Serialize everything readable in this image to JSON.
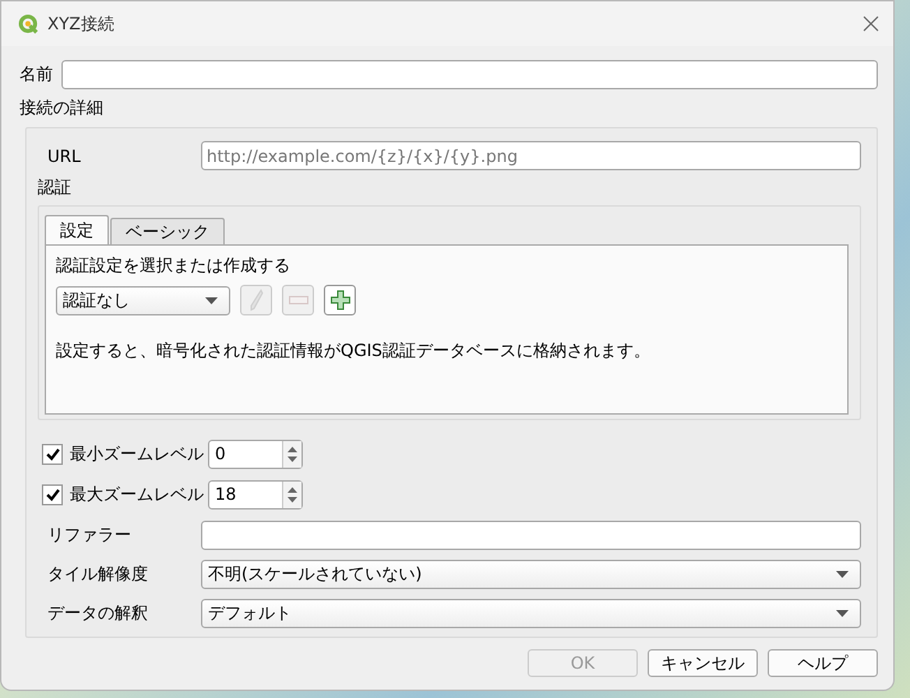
{
  "window": {
    "title": "XYZ接続"
  },
  "name": {
    "label": "名前"
  },
  "details": {
    "title": "接続の詳細",
    "url": {
      "label": "URL",
      "placeholder": "http://example.com/{z}/{x}/{y}.png"
    },
    "auth": {
      "title": "認証",
      "tabs": [
        {
          "label": "設定",
          "selected": true
        },
        {
          "label": "ベーシック",
          "selected": false
        }
      ],
      "prompt": "認証設定を選択または作成する",
      "config": "認証なし",
      "tools": [
        {
          "kind": "edit",
          "disabled": true
        },
        {
          "kind": "remove",
          "disabled": true
        },
        {
          "kind": "add",
          "disabled": false
        }
      ],
      "note": "設定すると、暗号化された認証情報がQGIS認証データベースに格納されます。"
    },
    "zoom": [
      {
        "label": "最小ズームレベル",
        "checked": true,
        "value": "0"
      },
      {
        "label": "最大ズームレベル",
        "checked": true,
        "value": "18"
      }
    ],
    "referer": {
      "label": "リファラー"
    },
    "selects": [
      {
        "label": "タイル解像度",
        "value": "不明(スケールされていない)"
      },
      {
        "label": "データの解釈",
        "value": "デフォルト"
      }
    ]
  },
  "buttons": [
    {
      "label": "OK",
      "disabled": true
    },
    {
      "label": "キャンセル",
      "disabled": false
    },
    {
      "label": "ヘルプ",
      "disabled": false
    }
  ]
}
